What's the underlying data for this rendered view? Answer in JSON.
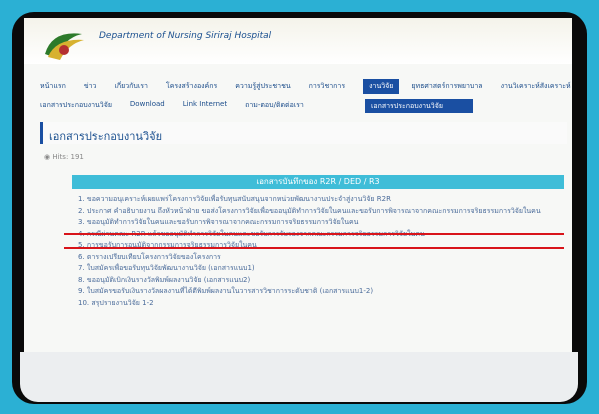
{
  "site": {
    "title": "Department of Nursing Siriraj Hospital"
  },
  "nav": {
    "row1": [
      "หน้าแรก",
      "ข่าว",
      "เกี่ยวกับเรา",
      "โครงสร้างองค์กร",
      "ความรู้สู่ประชาชน",
      "การวิชาการ",
      "งานวิจัย",
      "ยุทธศาสตร์การพยาบาล",
      "งานวิเคราะห์สังเคราะห์"
    ],
    "row2": [
      "เอกสารประกอบงานวิจัย",
      "Download",
      "Link Internet",
      "ถาม-ตอบ/ติดต่อเรา"
    ],
    "active_index": 6,
    "dropdown_item": "เอกสารประกอบงานวิจัย"
  },
  "page": {
    "title": "เอกสารประกอบงานวิจัย",
    "hits": "Hits: 191",
    "band": "เอกสารบันทึกของ R2R / DED / R3"
  },
  "documents": [
    "1. ขอความอนุเคราะห์เผยแพร่โครงการวิจัยเพื่อรับทุนสนับสนุนจากหน่วยพัฒนางานประจำสู่งานวิจัย R2R",
    "2. ประกาศ คำอธิบายงาน ถึงหัวหน้าฝ่าย ขอส่งโครงการวิจัยเพื่อขออนุมัติทำการวิจัยในคนและขอรับการพิจารณาจากคณะกรรมการจริยธรรมการวิจัยในคน",
    "3. ขออนุมัติทำการวิจัยในคนและขอรับการพิจารณาจากคณะกรรมการจริยธรรมการวิจัยในคน",
    "4. กรณีผ่านคณะ R2R แล้วขออนุมัติทำการวิจัยในคนและขอรับการรับรองจากคณะกรรมการจริยธรรมการวิจัยในคน",
    "5. การขอรับการอนุมัติจากกรรมการจริยธรรมการวิจัยในคน",
    "6. ตารางเปรียบเทียบโครงการวิจัยของโครงการ",
    "7. ใบสมัครเพื่อขอรับทุนวิจัยพัฒนางานวิจัย (เอกสารแนบ1)",
    "8. ขออนุมัติเบิกเงินรางวัลพิมพ์ผลงานวิจัย (เอกสารแนบ2)",
    "9. ใบสมัครขอรับเงินรางวัลผลงานที่ได้ตีพิมพ์ผลงานในวารสารวิชาการระดับชาติ (เอกสารแนบ1-2)",
    "10. สรุปรายงานวิจัย 1-2"
  ],
  "colors": {
    "background": "#2bb0d4",
    "frame": "#0a0a0a",
    "nav_active": "#1a4fa2",
    "band": "#3fbdd8",
    "highlight": "#d8141a"
  }
}
